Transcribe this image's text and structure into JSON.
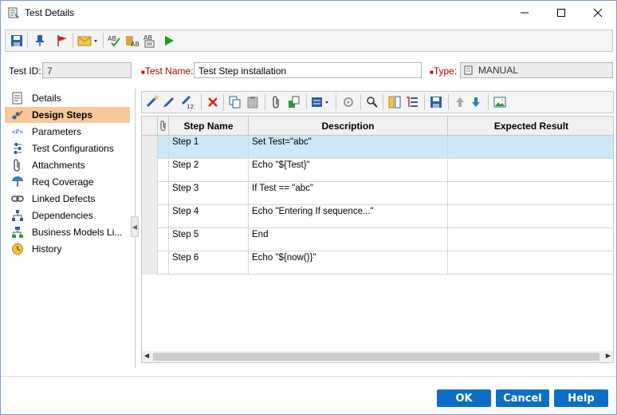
{
  "window": {
    "title": "Test Details",
    "controls": {
      "minimize_icon": "minimize-icon",
      "maximize_icon": "maximize-icon",
      "close_icon": "close-icon"
    }
  },
  "top_toolbar": {
    "icons": [
      "save-icon",
      "pin-icon",
      "flag-icon",
      "email-icon",
      "spell-check-icon",
      "thesaurus-icon",
      "spelling-options-icon",
      "run-icon"
    ]
  },
  "header": {
    "test_id_label": "Test ID:",
    "test_id_value": "7",
    "test_name_label": "Test Name:",
    "test_name_value": "Test Step installation",
    "type_label": "Type:",
    "type_value": "MANUAL"
  },
  "nav": {
    "items": [
      {
        "label": "Details",
        "icon": "details-icon"
      },
      {
        "label": "Design Steps",
        "icon": "design-steps-icon",
        "active": true
      },
      {
        "label": "Parameters",
        "icon": "parameters-icon"
      },
      {
        "label": "Test Configurations",
        "icon": "test-configurations-icon"
      },
      {
        "label": "Attachments",
        "icon": "attachments-icon"
      },
      {
        "label": "Req Coverage",
        "icon": "req-coverage-icon"
      },
      {
        "label": "Linked Defects",
        "icon": "linked-defects-icon"
      },
      {
        "label": "Dependencies",
        "icon": "dependencies-icon"
      },
      {
        "label": "Business Models Li...",
        "icon": "business-models-icon"
      },
      {
        "label": "History",
        "icon": "history-icon"
      }
    ]
  },
  "steps_toolbar": {
    "icons": [
      "new-step-icon",
      "edit-step-icon",
      "renumber-steps-icon",
      "delete-icon",
      "copy-icon",
      "paste-icon",
      "attachment-icon",
      "call-to-test-icon",
      "generate-script-icon",
      "parameters-icon",
      "find-icon",
      "select-columns-icon",
      "sort-icon",
      "save-icon",
      "move-up-icon",
      "move-down-icon",
      "view-icon"
    ]
  },
  "grid": {
    "attachment_column_icon": "paperclip-icon",
    "columns": [
      "Step Name",
      "Description",
      "Expected Result"
    ],
    "rows": [
      {
        "step": "Step 1",
        "description": "Set Test=\"abc\"",
        "expected": ""
      },
      {
        "step": "Step 2",
        "description": "Echo \"${Test}\"",
        "expected": ""
      },
      {
        "step": "Step 3",
        "description": "If Test == \"abc\"",
        "expected": ""
      },
      {
        "step": "Step 4",
        "description": "Echo \"Entering If sequence...\"",
        "expected": ""
      },
      {
        "step": "Step 5",
        "description": "End",
        "expected": ""
      },
      {
        "step": "Step 6",
        "description": "Echo \"${now()}\"",
        "expected": ""
      }
    ],
    "selected_row": 0
  },
  "buttons": {
    "ok": "OK",
    "cancel": "Cancel",
    "help": "Help"
  },
  "colors": {
    "accent": "#0b6ec4",
    "selection": "#cce8f6",
    "nav_active": "#f6c89a"
  }
}
